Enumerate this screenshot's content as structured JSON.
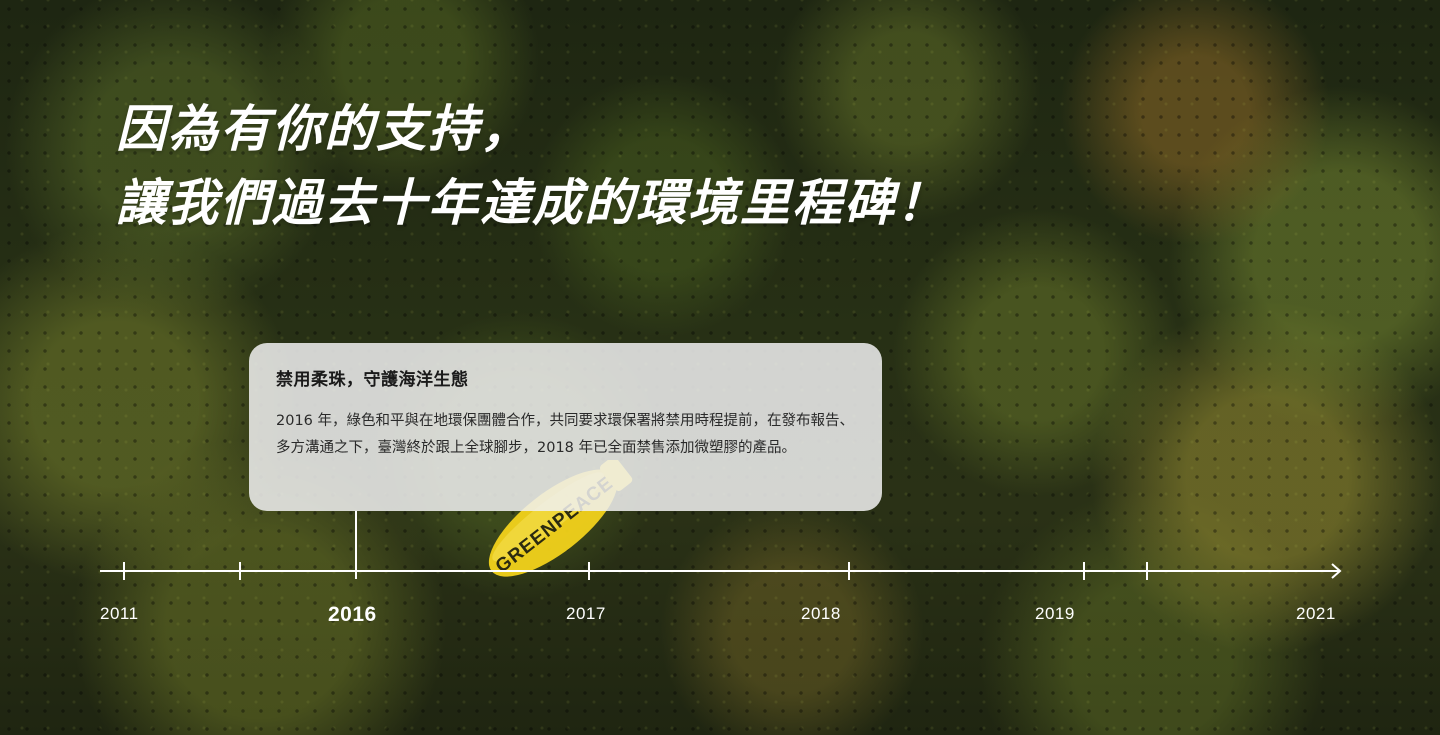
{
  "headline": {
    "line1": "因為有你的支持，",
    "line2": "讓我們過去十年達成的環境里程碑！"
  },
  "balloon": {
    "text": "GREENPEACE"
  },
  "milestone": {
    "title": "禁用柔珠，守護海洋生態",
    "body": "2016 年，綠色和平與在地環保團體合作，共同要求環保署將禁用時程提前，在發布報告、多方溝通之下，臺灣終於跟上全球腳步，2018 年已全面禁售添加微塑膠的產品。"
  },
  "timeline": {
    "active_year": "2016",
    "years": [
      {
        "label": "2011"
      },
      {
        "label": "2016"
      },
      {
        "label": "2017"
      },
      {
        "label": "2018"
      },
      {
        "label": "2019"
      },
      {
        "label": "2021"
      }
    ]
  },
  "colors": {
    "accent": "#ffffff",
    "balloon": "#f2d21b",
    "card_bg": "#f0f0f0"
  }
}
